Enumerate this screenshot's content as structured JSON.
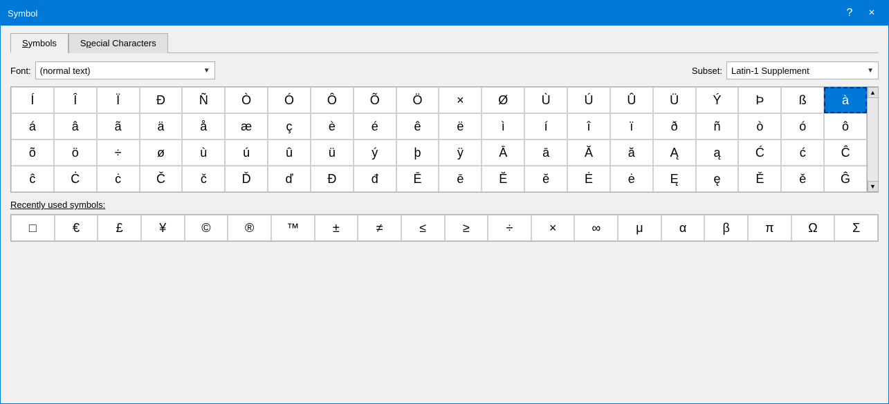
{
  "window": {
    "title": "Symbol",
    "help_label": "?",
    "close_label": "×"
  },
  "tabs": [
    {
      "id": "symbols",
      "label": "Symbols",
      "underline_index": 0,
      "active": true
    },
    {
      "id": "special",
      "label": "Special Characters",
      "underline_index": 1,
      "active": false
    }
  ],
  "font_label": "Font:",
  "font_value": "(normal text)",
  "subset_label": "Subset:",
  "subset_value": "Latin-1 Supplement",
  "symbols": [
    "Í",
    "Î",
    "Ï",
    "Ð",
    "Ñ",
    "Ò",
    "Ó",
    "Ô",
    "Õ",
    "Ö",
    "×",
    "Ø",
    "Ù",
    "Ú",
    "Û",
    "Ü",
    "Ý",
    "Þ",
    "ß",
    "à",
    "á",
    "â",
    "ã",
    "ä",
    "å",
    "æ",
    "ç",
    "è",
    "é",
    "ê",
    "ë",
    "ì",
    "í",
    "î",
    "ï",
    "ð",
    "ñ",
    "ò",
    "ó",
    "ô",
    "õ",
    "ö",
    "÷",
    "ø",
    "ù",
    "ú",
    "û",
    "ü",
    "ý",
    "þ",
    "ÿ",
    "Ā",
    "ā",
    "Ă",
    "ă",
    "Ą",
    "ą",
    "Ć",
    "ć",
    "Ĉ",
    "ĉ",
    "Ċ",
    "ċ",
    "Č",
    "č",
    "Ď",
    "ď",
    "Đ",
    "đ",
    "Ē",
    "ē",
    "Ĕ",
    "ĕ",
    "Ė",
    "ė",
    "Ę",
    "ę",
    "Ě",
    "ě",
    "Ĝ"
  ],
  "selected_index": 19,
  "recent_label": "Recently used symbols:",
  "recent_symbols": [
    "□",
    "€",
    "£",
    "¥",
    "©",
    "®",
    "™",
    "±",
    "≠",
    "≤",
    "≥",
    "÷",
    "×",
    "∞",
    "μ",
    "α",
    "β",
    "π",
    "Ω",
    "Σ"
  ]
}
